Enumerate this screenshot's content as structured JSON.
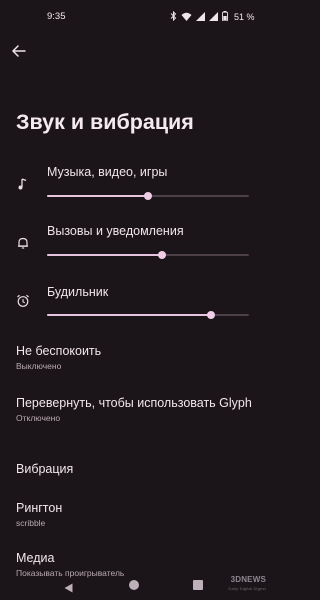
{
  "status_bar": {
    "time": "9:35",
    "battery_text": "51 %",
    "icons": [
      "bluetooth-icon",
      "wifi-icon",
      "signal-icon",
      "signal-icon",
      "battery-icon"
    ]
  },
  "header": {
    "back_icon": "arrow-back-icon",
    "title": "Звук и вибрация"
  },
  "volume_sliders": [
    {
      "icon": "music-note-icon",
      "label": "Музыка, видео, игры",
      "level": 0.5
    },
    {
      "icon": "bell-icon",
      "label": "Вызовы и уведомления",
      "level": 0.57
    },
    {
      "icon": "alarm-clock-icon",
      "label": "Будильник",
      "level": 0.81
    }
  ],
  "settings": [
    {
      "title": "Не беспокоить",
      "summary": "Выключено"
    },
    {
      "title": "Перевернуть, чтобы использовать Glyph",
      "summary": "Отключено"
    },
    {
      "title": "Вибрация",
      "summary": ""
    },
    {
      "title": "Рингтон",
      "summary": "scribble"
    },
    {
      "title": "Медиа",
      "summary": "Показывать проигрыватель"
    }
  ],
  "nav_bar": {
    "icons": [
      "nav-back-icon",
      "nav-home-icon",
      "nav-recents-icon"
    ]
  },
  "watermark": {
    "text": "3DNEWS",
    "subtext": "Daily Digital Digest"
  },
  "colors": {
    "background": "#1b1418",
    "accent": "#e6c4dc",
    "track": "#4c3f47"
  }
}
